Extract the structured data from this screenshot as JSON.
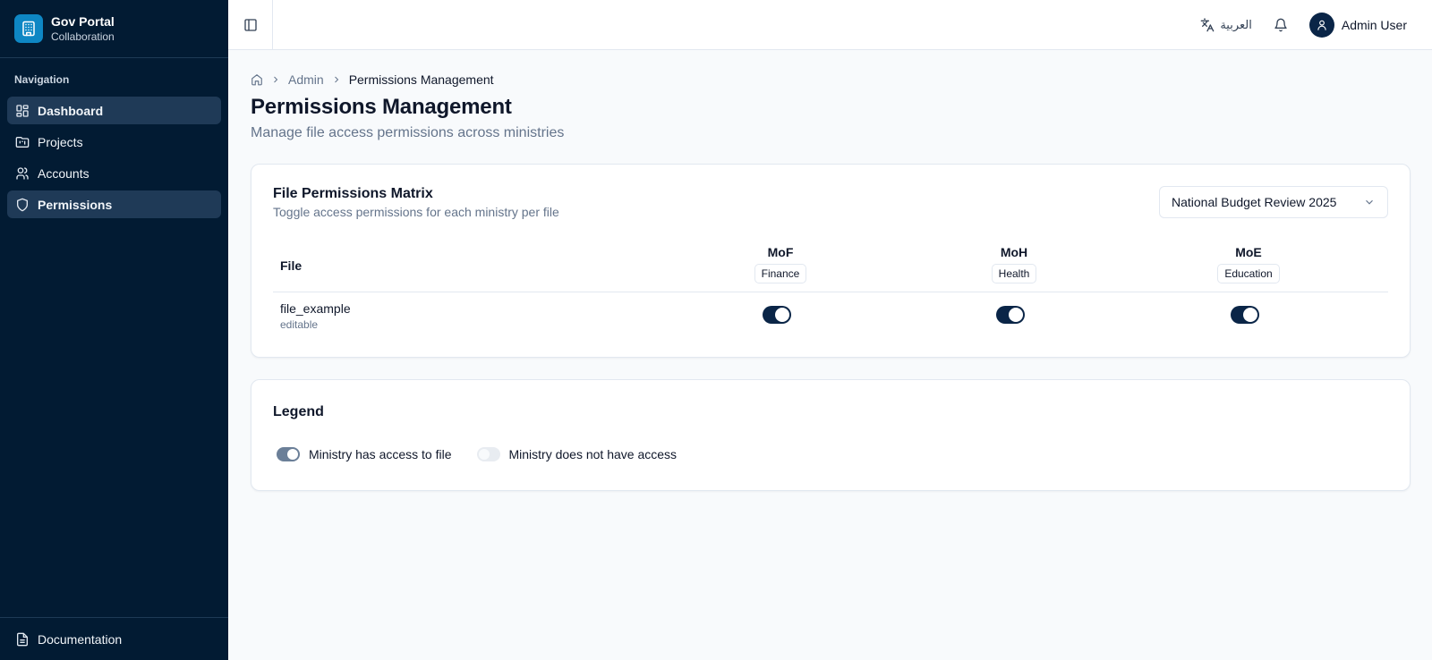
{
  "brand": {
    "name": "Gov Portal",
    "subtitle": "Collaboration",
    "icon": "building-icon"
  },
  "sidebar": {
    "heading": "Navigation",
    "items": [
      {
        "label": "Dashboard",
        "icon": "dashboard-icon",
        "active": true
      },
      {
        "label": "Projects",
        "icon": "projects-icon",
        "active": false
      },
      {
        "label": "Accounts",
        "icon": "users-icon",
        "active": false
      },
      {
        "label": "Permissions",
        "icon": "shield-icon",
        "active": true
      }
    ],
    "footer": {
      "label": "Documentation",
      "icon": "document-icon"
    }
  },
  "topbar": {
    "language_label": "العربية",
    "user_name": "Admin User"
  },
  "breadcrumb": {
    "items": [
      "Admin",
      "Permissions Management"
    ]
  },
  "page": {
    "title": "Permissions Management",
    "subtitle": "Manage file access permissions across ministries"
  },
  "matrix": {
    "title": "File Permissions Matrix",
    "subtitle": "Toggle access permissions for each ministry per file",
    "project_select": "National Budget Review 2025",
    "file_header": "File",
    "ministries": [
      {
        "code": "MoF",
        "name": "Finance"
      },
      {
        "code": "MoH",
        "name": "Health"
      },
      {
        "code": "MoE",
        "name": "Education"
      }
    ],
    "rows": [
      {
        "file": "file_example",
        "status": "editable",
        "access": [
          true,
          true,
          true
        ]
      }
    ]
  },
  "legend": {
    "title": "Legend",
    "has_access": "Ministry has access to file",
    "no_access": "Ministry does not have access"
  },
  "colors": {
    "sidebar_bg": "#021b33",
    "sidebar_active": "#1f3a57",
    "accent": "#0a2547",
    "brand_logo": "#0e87c4"
  }
}
